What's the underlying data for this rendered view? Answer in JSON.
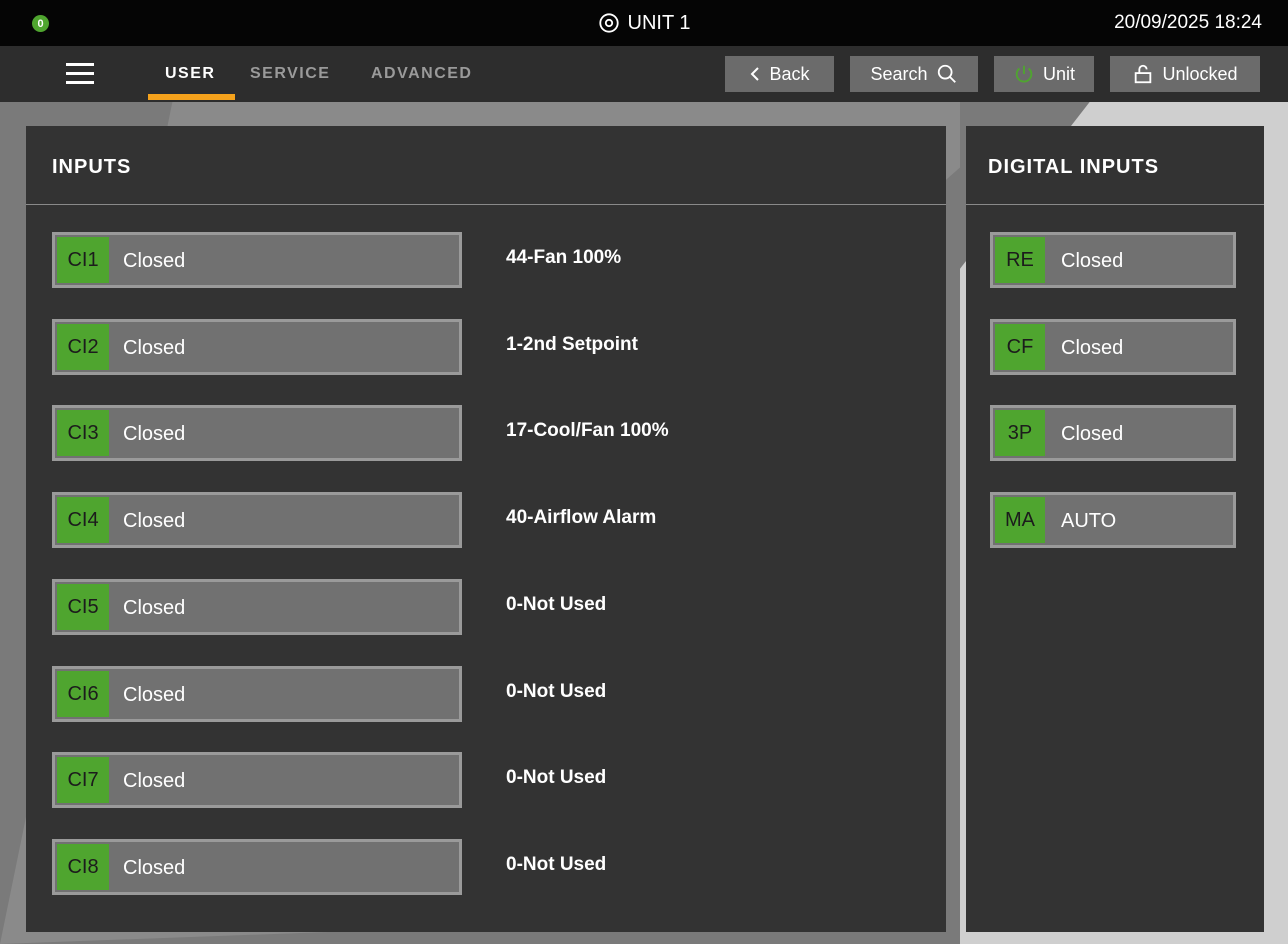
{
  "status": {
    "indicator": "0",
    "unit_name": "UNIT 1",
    "datetime": "20/09/2025 18:24",
    "accent_color": "#4fa52f"
  },
  "nav": {
    "tabs": [
      {
        "label": "USER",
        "active": true
      },
      {
        "label": "SERVICE",
        "active": false
      },
      {
        "label": "ADVANCED",
        "active": false
      }
    ],
    "back_label": "Back",
    "search_label": "Search",
    "unit_label": "Unit",
    "lock_label": "Unlocked",
    "tab_accent": "#f5a21c"
  },
  "inputs": {
    "title": "INPUTS",
    "items": [
      {
        "tag": "CI1",
        "state": "Closed",
        "function": "44-Fan 100%"
      },
      {
        "tag": "CI2",
        "state": "Closed",
        "function": "1-2nd Setpoint"
      },
      {
        "tag": "CI3",
        "state": "Closed",
        "function": "17-Cool/Fan 100%"
      },
      {
        "tag": "CI4",
        "state": "Closed",
        "function": "40-Airflow Alarm"
      },
      {
        "tag": "CI5",
        "state": "Closed",
        "function": "0-Not Used"
      },
      {
        "tag": "CI6",
        "state": "Closed",
        "function": "0-Not Used"
      },
      {
        "tag": "CI7",
        "state": "Closed",
        "function": "0-Not Used"
      },
      {
        "tag": "CI8",
        "state": "Closed",
        "function": "0-Not Used"
      }
    ]
  },
  "digital_inputs": {
    "title": "DIGITAL INPUTS",
    "items": [
      {
        "tag": "RE",
        "state": "Closed"
      },
      {
        "tag": "CF",
        "state": "Closed"
      },
      {
        "tag": "3P",
        "state": "Closed"
      },
      {
        "tag": "MA",
        "state": "AUTO"
      }
    ]
  }
}
